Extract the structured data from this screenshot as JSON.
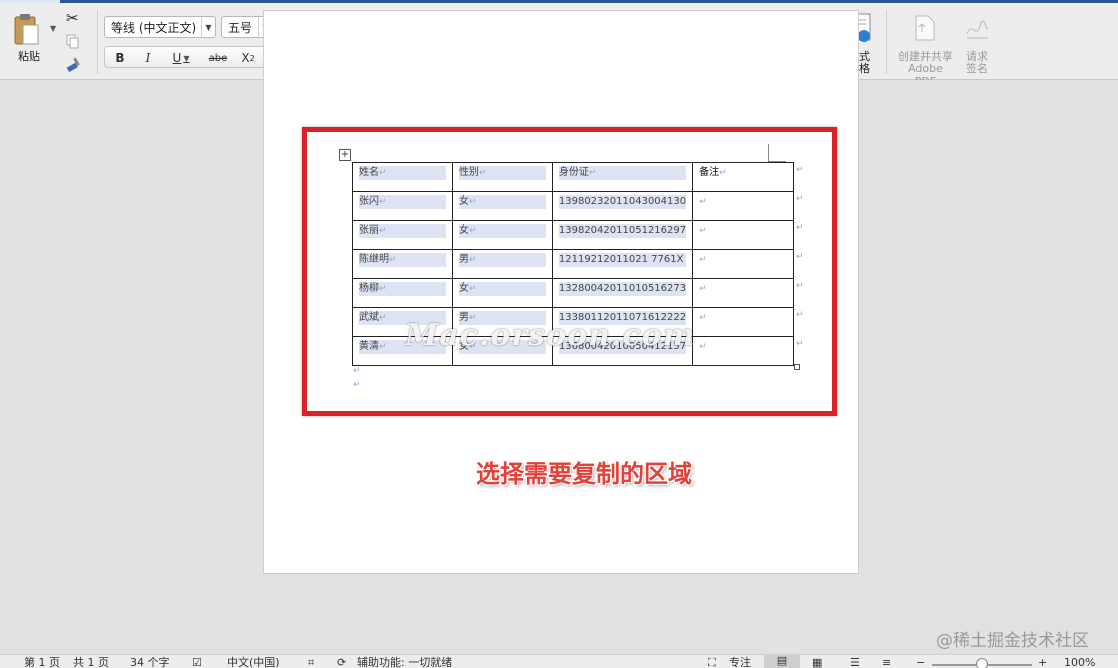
{
  "ribbon": {
    "clipboard": {
      "paste_label": "粘贴"
    },
    "font": {
      "name": "等线 (中文正文)",
      "size": "五号"
    },
    "styles_label": "样式",
    "styles_pane_label": [
      "样式",
      "窗格"
    ],
    "adobe_label": [
      "创建并共享",
      "Adobe PDF"
    ],
    "sign_label": [
      "请求",
      "签名"
    ]
  },
  "table": {
    "headers": [
      "姓名",
      "性别",
      "身份证",
      "备注"
    ],
    "rows": [
      [
        "张闪",
        "女",
        "13980232011043004130",
        ""
      ],
      [
        "张丽",
        "女",
        "13982042011051216297",
        ""
      ],
      [
        "陈继明",
        "男",
        "12119212011021 7761X",
        ""
      ],
      [
        "杨柳",
        "女",
        "13280042011010516273",
        ""
      ],
      [
        "武斌",
        "男",
        "13380112011071612222",
        ""
      ],
      [
        "黄清",
        "女",
        "13680042010050412157",
        ""
      ]
    ]
  },
  "watermark": "Mac.orsoon.com",
  "caption": "选择需要复制的区域",
  "corner_watermark": "@稀土掘金技术社区",
  "statusbar": {
    "page": "第 1 页",
    "total": "共 1 页",
    "words": "34 个字",
    "language": "中文(中国)",
    "accessibility": "辅助功能: 一切就绪",
    "focus": "专注",
    "zoom": "100%"
  },
  "colors": {
    "accent": "#2b5797",
    "highlight_frame": "#d9232a",
    "caption": "#e0413b"
  }
}
